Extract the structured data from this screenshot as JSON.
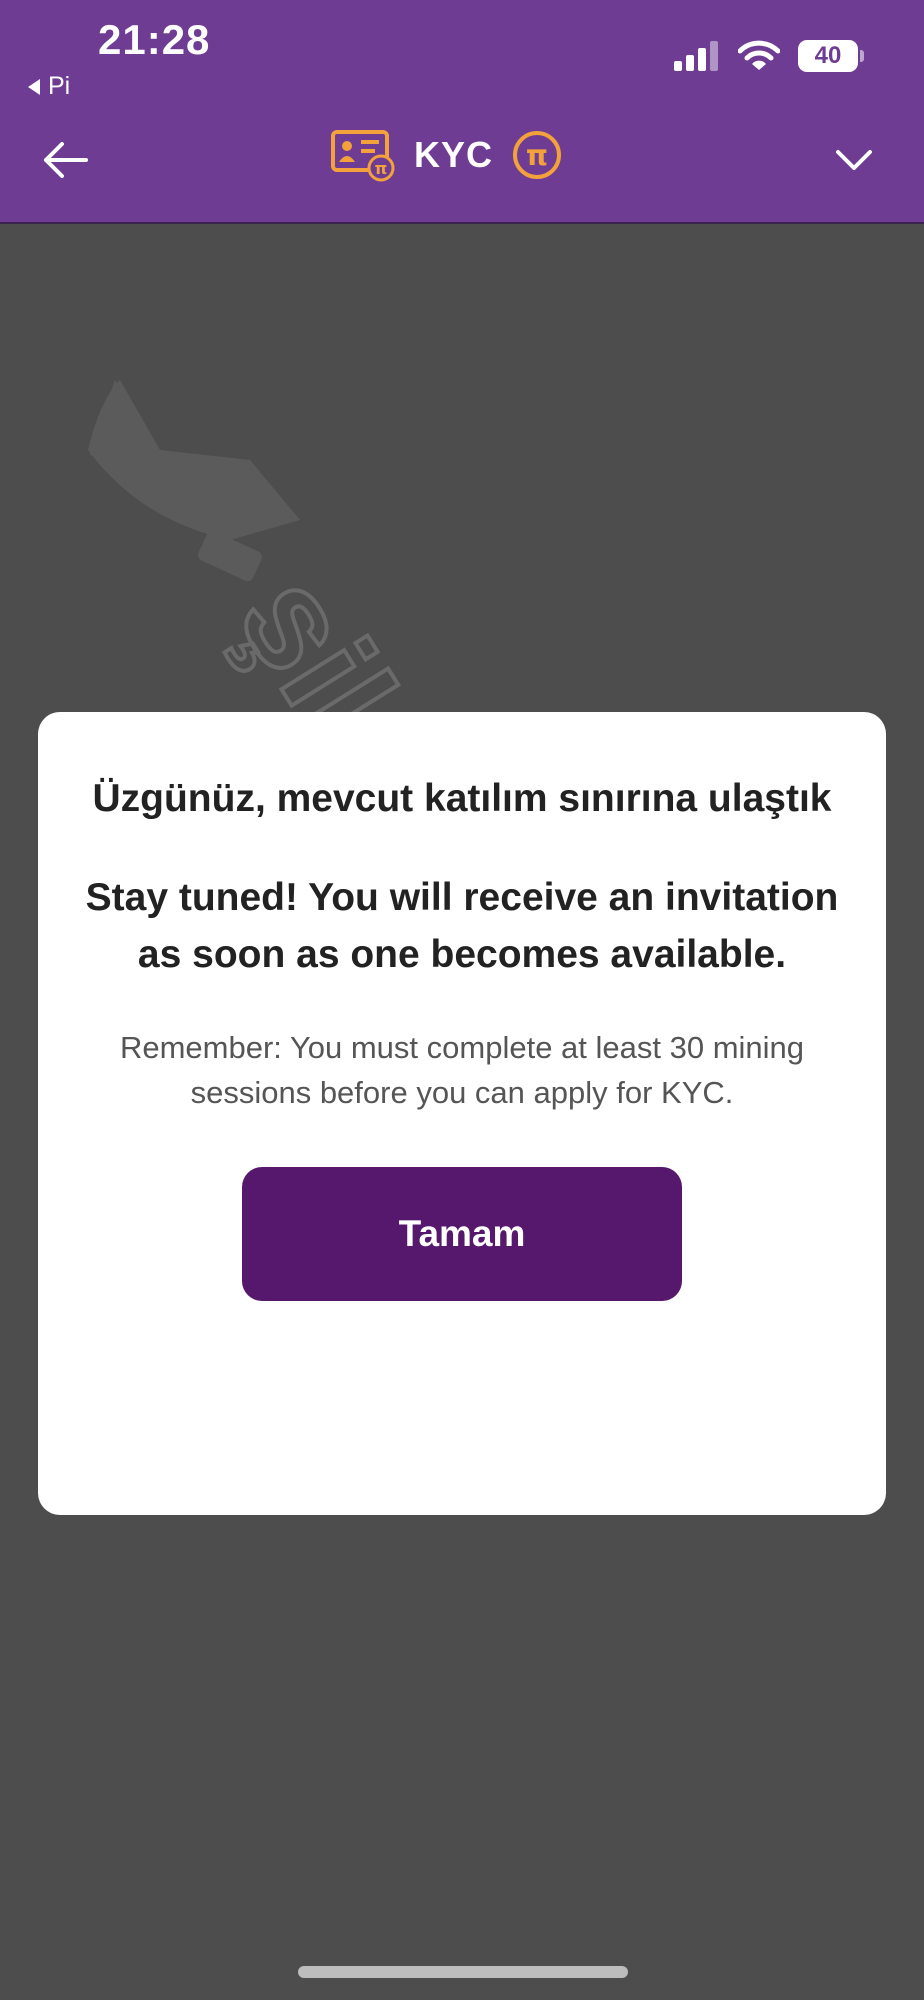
{
  "status_bar": {
    "time": "21:28",
    "back_app_label": "Pi",
    "battery_level": "40"
  },
  "nav": {
    "title": "KYC",
    "back_icon": "arrow-left-icon",
    "dropdown_icon": "chevron-down-icon",
    "id_card_icon": "id-card-icon",
    "pi_coin_icon": "pi-coin-icon"
  },
  "modal": {
    "title": "Üzgünüz, mevcut katılım sınırına ulaştık",
    "subtitle": "Stay tuned! You will receive an invitation as soon as one becomes available.",
    "note": "Remember: You must complete at least 30 mining sessions before you can apply for KYC.",
    "button_label": "Tamam"
  },
  "watermark_text": "şikayetvar",
  "colors": {
    "header_bg": "#6f3c93",
    "overlay_bg": "#4d4d4d",
    "button_bg": "#55186c",
    "accent_gold": "#f3a23b"
  }
}
